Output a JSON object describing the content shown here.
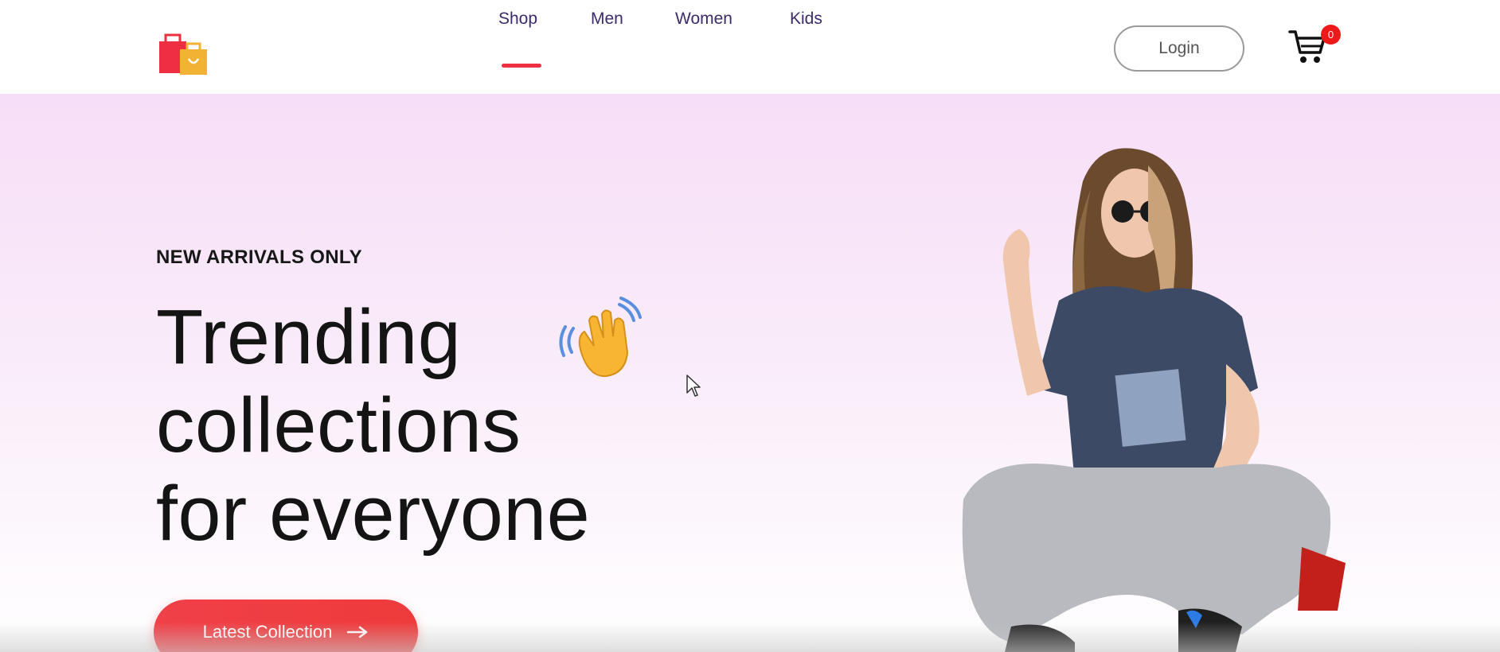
{
  "navbar": {
    "logo_icon": "shopping-bags-icon",
    "links": [
      {
        "label": "Shop",
        "active": true
      },
      {
        "label": "Men",
        "active": false
      },
      {
        "label": "Women",
        "active": false
      },
      {
        "label": "Kids",
        "active": false
      }
    ],
    "login_label": "Login",
    "cart_icon": "cart-icon",
    "cart_count": "0"
  },
  "hero": {
    "tagline": "NEW ARRIVALS ONLY",
    "title_lines": [
      "Trending",
      "collections",
      "for everyone"
    ],
    "wave_icon": "waving-hand-icon",
    "cta_label": "Latest Collection",
    "cta_icon": "arrow-right-icon",
    "image": "model-photo"
  },
  "colors": {
    "accent": "#ee2f42",
    "nav_text": "#3d2a6b",
    "hero_bg_top": "#f7def8",
    "cart_badge": "#f01919"
  }
}
